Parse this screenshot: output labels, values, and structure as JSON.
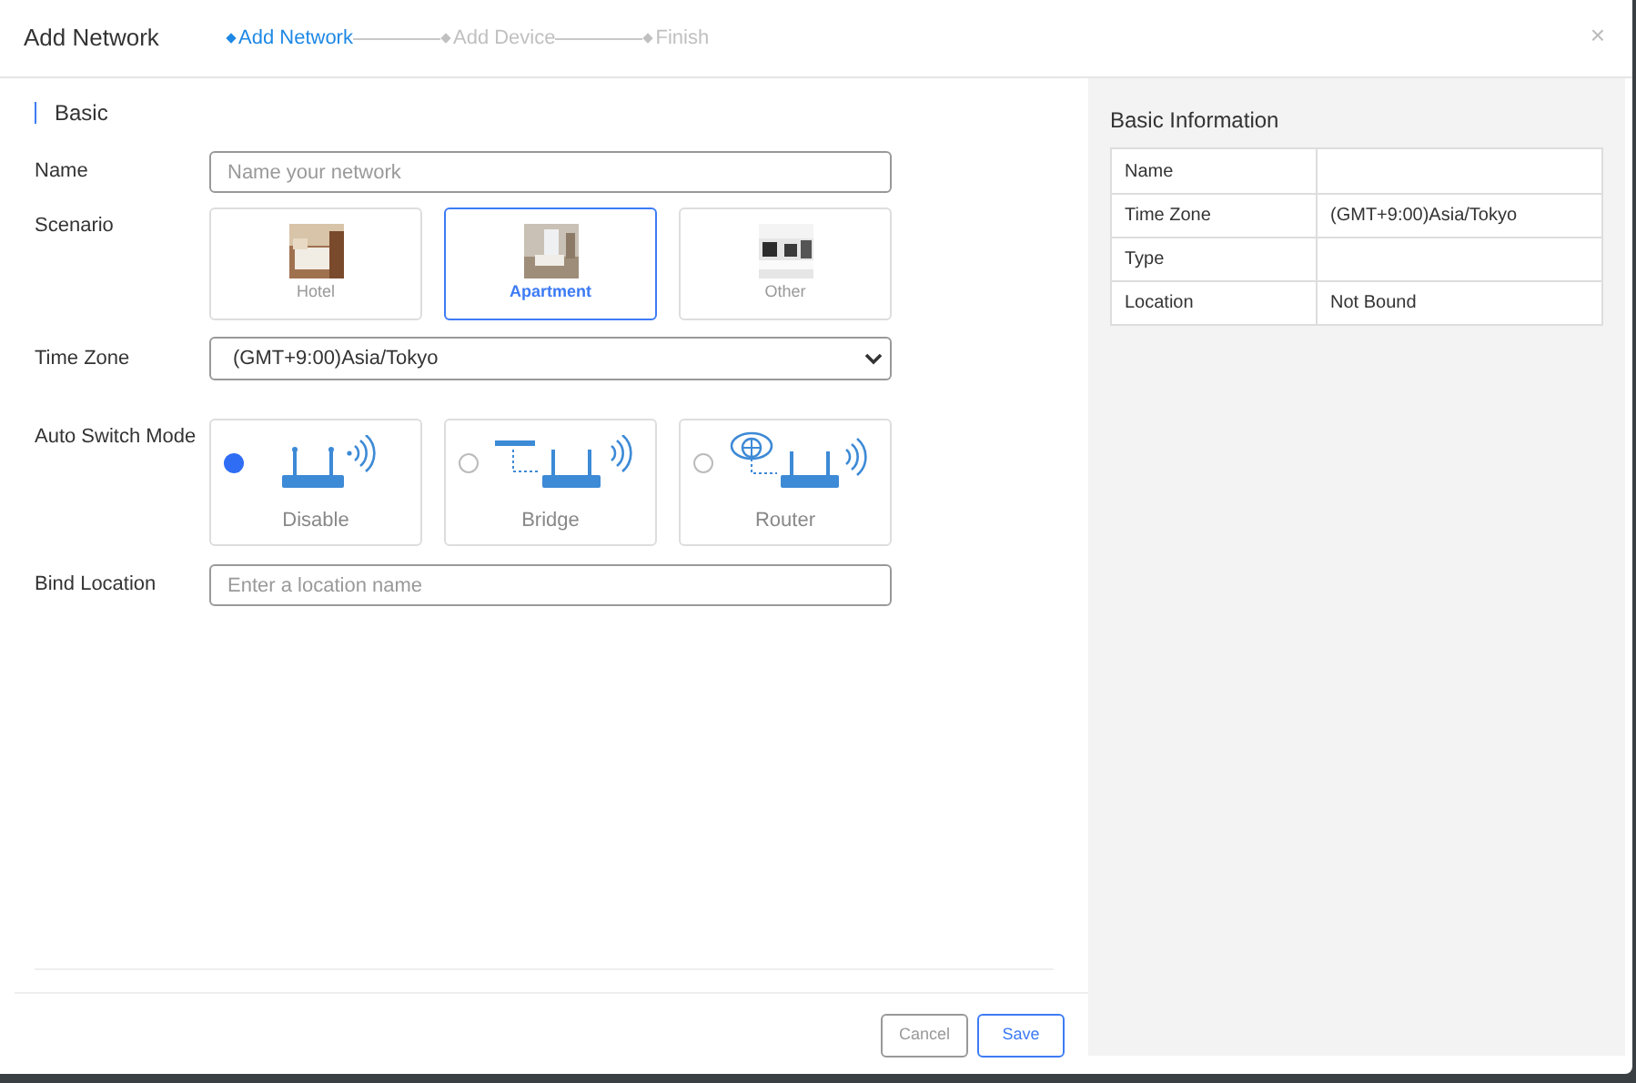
{
  "window": {
    "title": "Add Network",
    "close": "×"
  },
  "steps": [
    {
      "label": "Add Network",
      "selected": true
    },
    {
      "label": "Add Device",
      "selected": false
    },
    {
      "label": "Finish",
      "selected": false
    }
  ],
  "section": {
    "title": "Basic"
  },
  "form": {
    "name_label": "Name",
    "name_placeholder": "Name your network",
    "scenario_label": "Scenario",
    "scenarios": [
      {
        "label": "Hotel",
        "selected": false,
        "kind": "picture"
      },
      {
        "label": "Apartment",
        "selected": true,
        "kind": "picture"
      },
      {
        "label": "Other",
        "selected": false,
        "kind": "picture"
      }
    ],
    "timezone_label": "Time Zone",
    "timezone_value": "(GMT+9:00)Asia/Tokyo",
    "mode_label": "Auto Switch Mode",
    "modes": [
      {
        "label": "Disable",
        "selected": true,
        "kind": "router"
      },
      {
        "label": "Bridge",
        "selected": false,
        "kind": "bridge"
      },
      {
        "label": "Router",
        "selected": false,
        "kind": "gateway"
      }
    ],
    "location_label": "Bind Location",
    "location_placeholder": "Enter a location name"
  },
  "buttons": [
    {
      "label": "Cancel",
      "kind": "secondary"
    },
    {
      "label": "Save",
      "kind": "primary"
    }
  ],
  "info": {
    "title": "Basic Information",
    "rows": [
      {
        "key": "Name"
      },
      {
        "key": "Time Zone",
        "value": "(GMT+9:00)Asia/Tokyo"
      },
      {
        "key": "Type"
      },
      {
        "key": "Location",
        "value": "Not Bound"
      }
    ]
  }
}
